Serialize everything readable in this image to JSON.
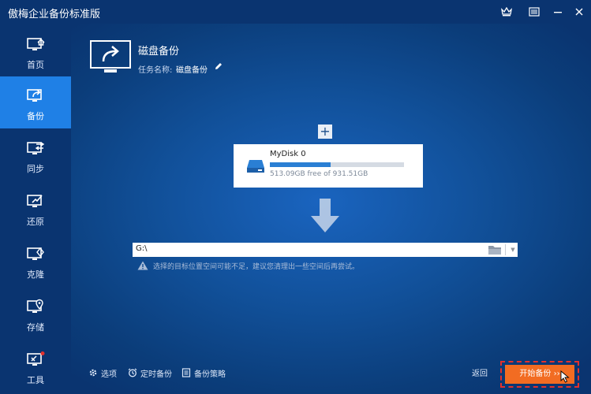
{
  "window": {
    "title": "傲梅企业备份标准版"
  },
  "sidebar": {
    "items": [
      {
        "label": "首页",
        "icon": "home-icon"
      },
      {
        "label": "备份",
        "icon": "backup-icon",
        "active": true
      },
      {
        "label": "同步",
        "icon": "sync-icon"
      },
      {
        "label": "还原",
        "icon": "restore-icon"
      },
      {
        "label": "克隆",
        "icon": "clone-icon"
      },
      {
        "label": "存储",
        "icon": "storage-icon"
      },
      {
        "label": "工具",
        "icon": "tools-icon"
      }
    ]
  },
  "task": {
    "title": "磁盘备份",
    "name_label": "任务名称:",
    "name_value": "磁盘备份"
  },
  "source": {
    "add_symbol": "+",
    "disk_name": "MyDisk 0",
    "disk_free": "513.09GB free of 931.51GB",
    "used_fraction": 0.45
  },
  "destination": {
    "path": "G:\\",
    "warning": "选择的目标位置空间可能不足，建议您清理出一些空间后再尝试。"
  },
  "bottom": {
    "options_label": "选项",
    "schedule_label": "定时备份",
    "scheme_label": "备份策略",
    "back_label": "返回",
    "start_label": "开始备份 ››"
  },
  "colors": {
    "sidebar_bg": "#0a3470",
    "active_nav": "#1f80e6",
    "start_button": "#f26c22",
    "highlight_border": "#e3312d"
  }
}
